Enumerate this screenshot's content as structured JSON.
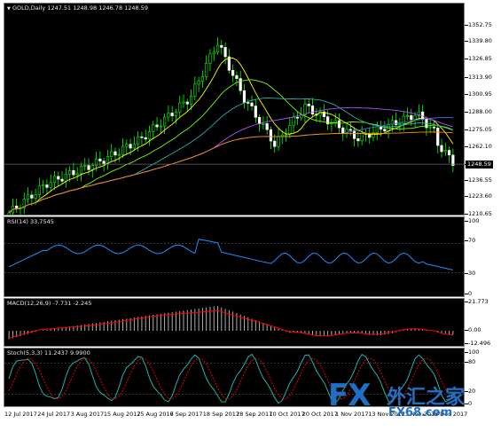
{
  "header": {
    "symbol_label": "GOLD,Daily",
    "ohlc": "1247.51 1248.98 1246.78 1248.59",
    "arrow_icon": "triangle-down-icon"
  },
  "price_scale": {
    "ticks": [
      "1352.75",
      "1339.80",
      "1326.85",
      "1313.90",
      "1300.95",
      "1288.00",
      "1275.05",
      "1262.10",
      "1248.59",
      "1236.55",
      "1223.60",
      "1210.65"
    ],
    "current_price": "1248.59"
  },
  "rsi": {
    "label": "RSI(14) 33.7545",
    "ticks": [
      "100",
      "70",
      "30",
      "0"
    ]
  },
  "macd": {
    "label": "MACD(12,26,9) -7.731 -2.245",
    "ticks": [
      "21.773",
      "0.00",
      "-12.496"
    ]
  },
  "stoch": {
    "label": "Stoch(5,3,3) 11.2437 9.9900",
    "ticks": [
      "100",
      "80",
      "20",
      "0"
    ]
  },
  "time_axis": {
    "labels": [
      "12 Jul 2017",
      "24 Jul 2017",
      "3 Aug 2017",
      "15 Aug 2017",
      "25 Aug 2017",
      "6 Sep 2017",
      "18 Sep 2017",
      "28 Sep 2017",
      "10 Oct 2017",
      "20 Oct 2017",
      "1 Nov 2017",
      "13 Nov 2017",
      "23 Nov 2017",
      "5 Dec 2017"
    ]
  },
  "watermark": {
    "brand": "FX",
    "cn": "外汇之家",
    "url": "FX68.com"
  },
  "colors": {
    "bull_candle": "#ffffff",
    "bear_candle": "#00ff00",
    "rsi_line": "#1e90ff",
    "macd_hist": "#c0c0c0",
    "macd_signal": "#ff0000",
    "stoch_main": "#20b2aa",
    "stoch_signal": "#ff0000"
  }
}
